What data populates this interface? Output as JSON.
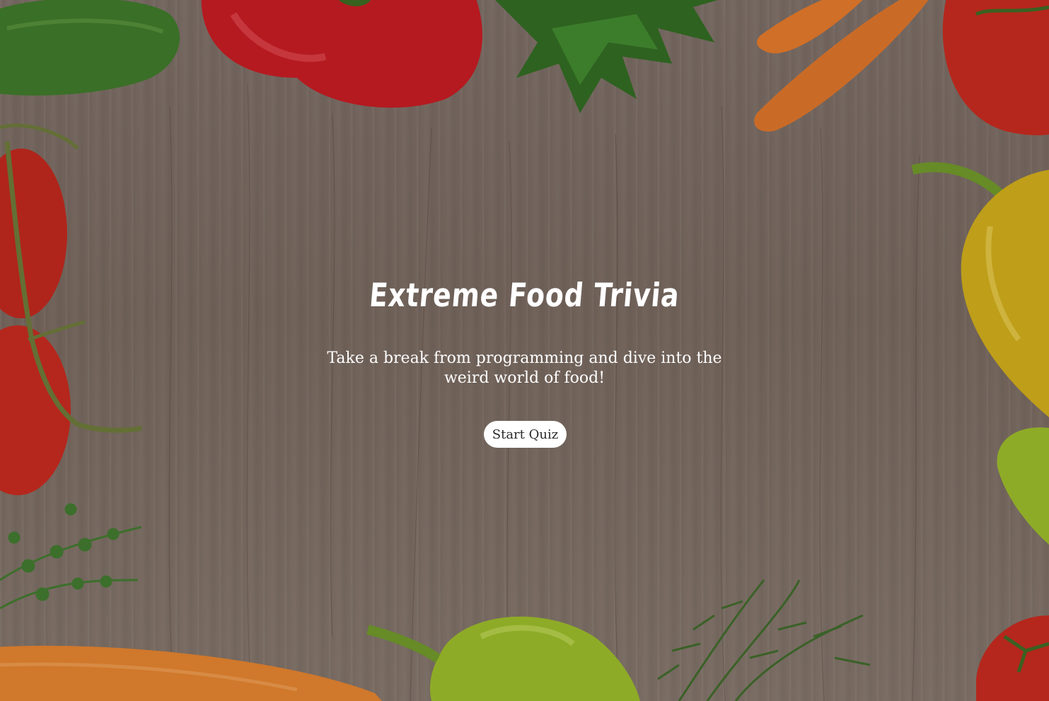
{
  "page": {
    "title": "Extreme Food Trivia",
    "subtitle_line1": "Take a break from programming and dive into the",
    "subtitle_line2": "weird world of food!"
  },
  "actions": {
    "start_label": "Start Quiz"
  },
  "background": {
    "description_icons": [
      "cucumber",
      "red-pepper",
      "parsley",
      "carrot",
      "tomato",
      "yellow-pepper",
      "green-pepper",
      "rosemary",
      "thyme"
    ],
    "colors": {
      "wood": "#7f716a",
      "tomato": "#c9281d",
      "red_pepper": "#d01a22",
      "carrot": "#e87a2a",
      "parsley": "#2f6b22",
      "yellow_pepper": "#d4b01a",
      "green_pepper": "#9cbf2a",
      "cucumber": "#3d7a2a"
    }
  }
}
